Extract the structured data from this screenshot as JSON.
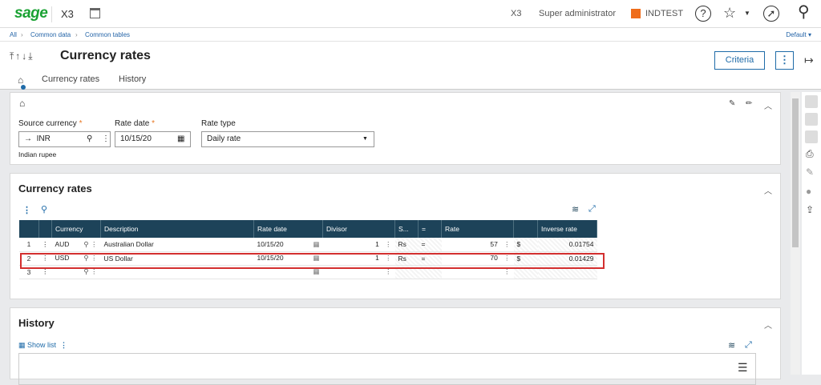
{
  "topbar": {
    "logo": "sage",
    "app": "X3",
    "folder_code": "X3",
    "user": "Super administrator",
    "folder": "INDTEST"
  },
  "breadcrumb": {
    "items": [
      "All",
      "Common data",
      "Common tables"
    ],
    "right": "Default"
  },
  "header": {
    "title": "Currency rates",
    "criteria_label": "Criteria",
    "tabs": [
      "Currency rates",
      "History"
    ]
  },
  "criteria_panel": {
    "source_currency": {
      "label": "Source currency",
      "value": "INR",
      "description": "Indian rupee"
    },
    "rate_date": {
      "label": "Rate date",
      "value": "10/15/20"
    },
    "rate_type": {
      "label": "Rate type",
      "value": "Daily rate"
    }
  },
  "rates_panel": {
    "title": "Currency rates",
    "columns": [
      "Currency",
      "Description",
      "Rate date",
      "Divisor",
      "S...",
      "=",
      "Rate",
      "",
      "Inverse rate"
    ],
    "rows": [
      {
        "n": "1",
        "currency": "AUD",
        "description": "Australian Dollar",
        "date": "10/15/20",
        "divisor": "1",
        "symbol": "Rs",
        "eq": "=",
        "rate": "57",
        "cur_sym": "$",
        "inverse": "0.01754"
      },
      {
        "n": "2",
        "currency": "USD",
        "description": "US Dollar",
        "date": "10/15/20",
        "divisor": "1",
        "symbol": "Rs",
        "eq": "=",
        "rate": "70",
        "cur_sym": "$",
        "inverse": "0.01429"
      },
      {
        "n": "3",
        "currency": "",
        "description": "",
        "date": "",
        "divisor": "",
        "symbol": "",
        "eq": "",
        "rate": "",
        "cur_sym": "",
        "inverse": ""
      }
    ]
  },
  "history_panel": {
    "title": "History",
    "show_list": "Show list"
  },
  "colors": {
    "accent": "#1f6ba8",
    "header_bg": "#1d4359",
    "sage_green": "#1aa233",
    "folder_orange": "#ef6c1a",
    "highlight": "#d32f2f"
  }
}
